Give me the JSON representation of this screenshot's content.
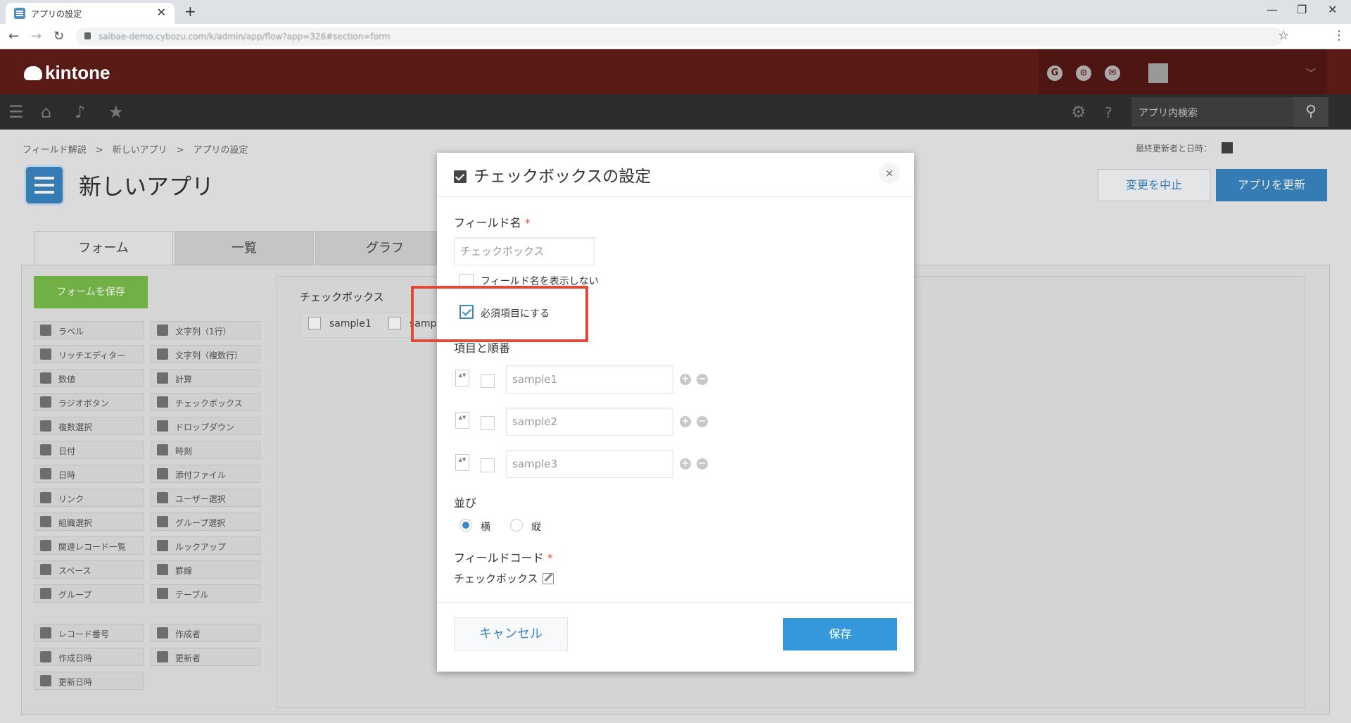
{
  "browser": {
    "tab_title": "アプリの設定",
    "url": "saibae-demo.cybozu.com/k/admin/app/flow?app=326#section=form"
  },
  "header": {
    "logo": "kintone",
    "icons": [
      "G",
      "⊙",
      "✉"
    ]
  },
  "toolbar": {
    "search_placeholder": "アプリ内検索"
  },
  "page": {
    "breadcrumb": "フィールド解説　>　新しいアプリ　>　アプリの設定",
    "app_title": "新しいアプリ",
    "last_modified_label": "最終更新者と日時：",
    "cancel_label": "変更を中止",
    "update_label": "アプリを更新",
    "tabs": [
      "フォーム",
      "一覧",
      "グラフ"
    ],
    "save_form_label": "フォームを保存",
    "palette_left": [
      "ラベル",
      "リッチエディター",
      "数値",
      "ラジオボタン",
      "複数選択",
      "日付",
      "日時",
      "リンク",
      "組織選択",
      "関連レコード一覧",
      "スペース",
      "グループ"
    ],
    "palette_right": [
      "文字列（1行）",
      "文字列（複数行）",
      "計算",
      "チェックボックス",
      "ドロップダウン",
      "時刻",
      "添付ファイル",
      "ユーザー選択",
      "グループ選択",
      "ルックアップ",
      "罫線",
      "テーブル"
    ],
    "system_left": [
      "レコード番号",
      "作成日時",
      "更新日時"
    ],
    "system_right": [
      "作成者",
      "更新者"
    ],
    "canvas_field_label": "チェックボックス",
    "canvas_options": [
      "sample1",
      "samp"
    ]
  },
  "dialog": {
    "title": "チェックボックスの設定",
    "close": "×",
    "field_name_label": "フィールド名",
    "required_mark": "*",
    "field_name_value": "チェックボックス",
    "hide_name_label": "フィールド名を表示しない",
    "required_label": "必須項目にする",
    "required_checked": true,
    "options_label": "項目と順番",
    "options": [
      "sample1",
      "sample2",
      "sample3"
    ],
    "plus": "+",
    "minus": "−",
    "spinner": "▲▼",
    "layout_label": "並び",
    "layout_horizontal": "横",
    "layout_vertical": "縦",
    "layout_selected": "横",
    "field_code_label": "フィールドコード",
    "field_code_value": "チェックボックス",
    "cancel_label": "キャンセル",
    "save_label": "保存"
  },
  "colors": {
    "kintone_header": "#5a1a15",
    "accent_blue": "#3b87c4",
    "save_green": "#7bbf4b",
    "highlight_red": "#e04a3a"
  }
}
